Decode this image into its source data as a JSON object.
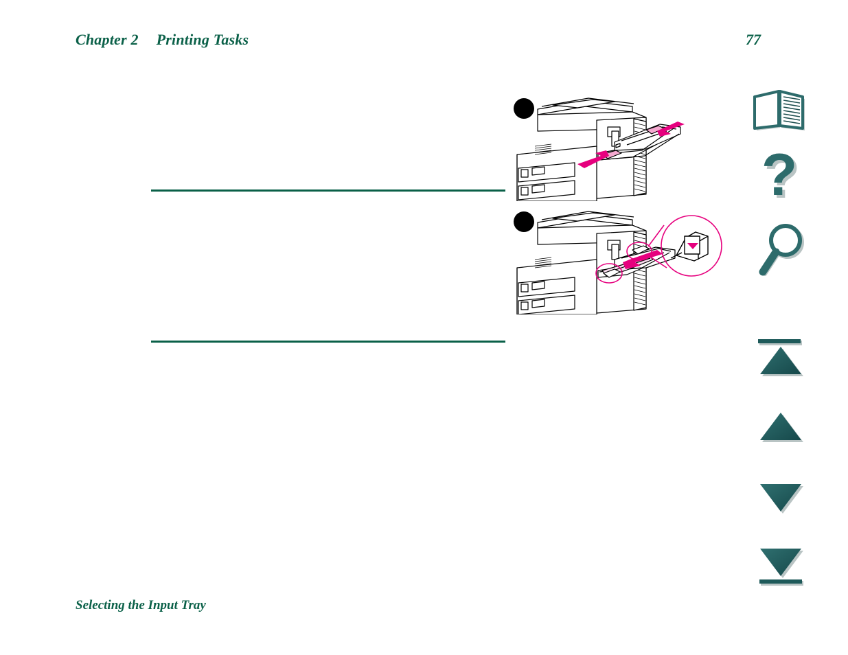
{
  "document": {
    "page_background": "#ffffff",
    "accent_green": "#0a6048",
    "icon_teal": "#2d6b6b",
    "callout_magenta": "#e6007e",
    "line_art_black": "#000000"
  },
  "header": {
    "chapter_label": "Chapter 2",
    "section_title": "Printing Tasks",
    "page_number": "77"
  },
  "body": {
    "paragraph_1": "",
    "paragraph_2": "",
    "paragraph_3": ""
  },
  "figures": [
    {
      "id": "figure-tray1-adjust-guides",
      "step_bullet": "",
      "caption": "",
      "alt": "Line drawing of printer with tray 1 open and magenta arrows pointing inward at the paper width guides",
      "arrows": "magenta",
      "highlight_color": "#f5a9d0"
    },
    {
      "id": "figure-tray1-load-paper",
      "step_bullet": "",
      "caption": "",
      "alt": "Line drawing of printer with paper being inserted into tray 1 and a magnified callout circle showing the fill level mark",
      "arrows": "magenta",
      "callout": "fill-level mark detail"
    }
  ],
  "nav": {
    "items": [
      {
        "name": "book-icon",
        "label": "Contents"
      },
      {
        "name": "question-mark-icon",
        "label": "Help"
      },
      {
        "name": "magnifier-icon",
        "label": "Search"
      },
      {
        "name": "first-page-icon",
        "label": "First Page"
      },
      {
        "name": "previous-page-icon",
        "label": "Previous Page"
      },
      {
        "name": "next-page-icon",
        "label": "Next Page"
      },
      {
        "name": "last-page-icon",
        "label": "Last Page"
      }
    ]
  },
  "footer": {
    "section_link": "Selecting the Input Tray"
  }
}
